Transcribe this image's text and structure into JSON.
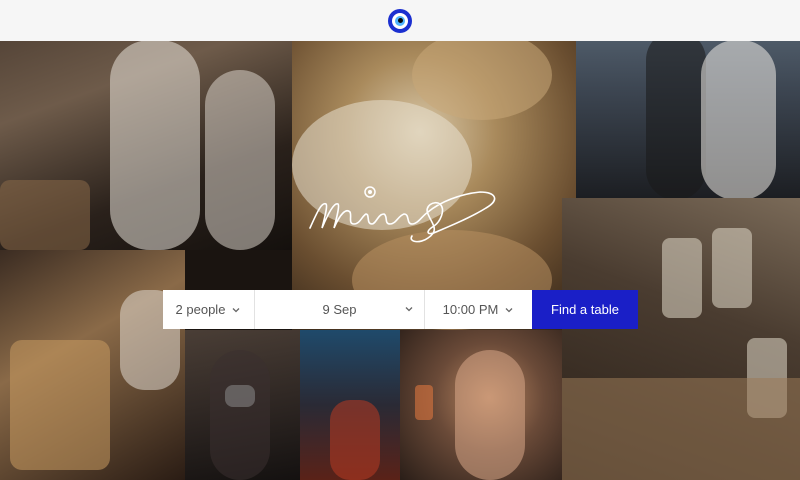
{
  "header": {
    "logo_icon": "evil-eye-icon",
    "logo_colors": [
      "#1b2fd0",
      "#ffffff",
      "#4fb3ff",
      "#0a0a0a"
    ]
  },
  "brand": {
    "wordmark": "MemberS",
    "wordmark_color": "#ffffff"
  },
  "reservation": {
    "people_value": "2 people",
    "date_value": "9 Sep",
    "time_value": "10:00 PM",
    "find_label": "Find a table",
    "chevron_icon": "chevron-down-icon",
    "button_color": "#1a1fc7"
  },
  "gallery": {
    "photos": [
      "party-guests-photo",
      "wine-corks-photo",
      "two-women-photo",
      "toast-jars-photo",
      "cheese-board-photo",
      "masked-dancer-photo",
      "dance-floor-photo",
      "woman-cocktail-photo"
    ]
  }
}
